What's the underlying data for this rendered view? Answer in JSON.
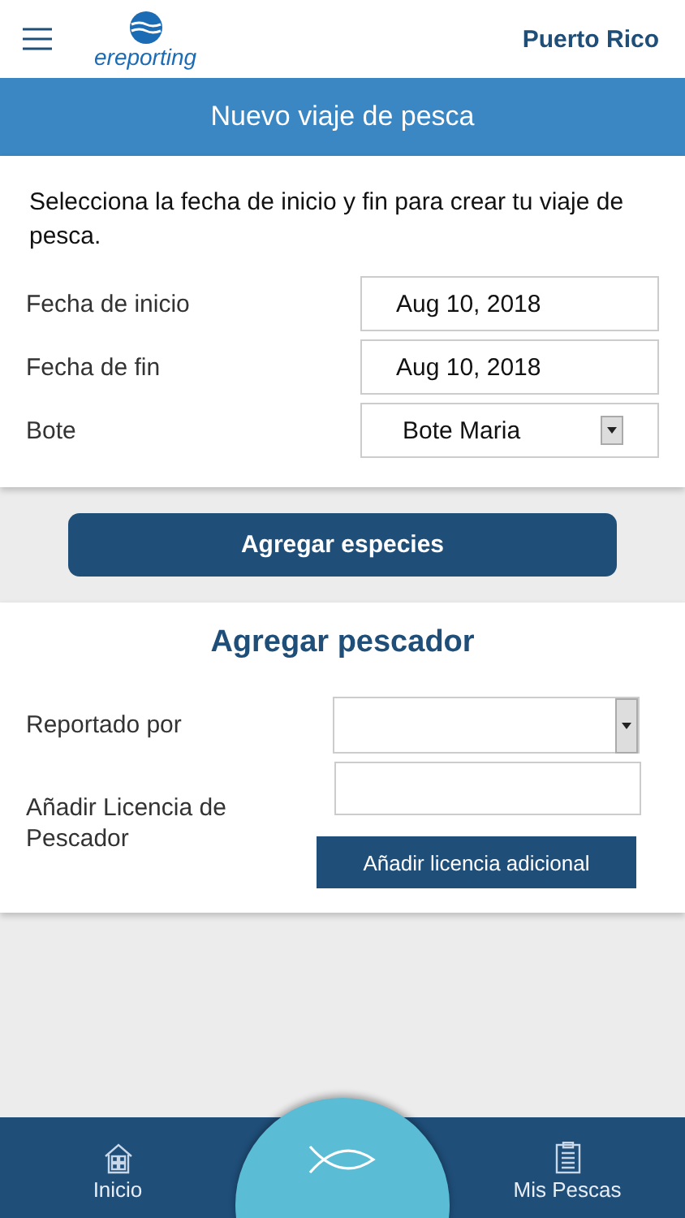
{
  "header": {
    "brand": "ereporting",
    "region": "Puerto Rico"
  },
  "banner": {
    "title": "Nuevo viaje de pesca"
  },
  "trip": {
    "instructions": "Selecciona la fecha de inicio y fin para crear tu viaje de pesca.",
    "fields": [
      {
        "label": "Fecha de inicio",
        "kind": "date",
        "value": "Aug 10, 2018"
      },
      {
        "label": "Fecha de fin",
        "kind": "date",
        "value": "Aug 10, 2018"
      },
      {
        "label": "Bote",
        "kind": "select",
        "value": "Bote Maria"
      }
    ]
  },
  "species_button": "Agregar especies",
  "fisher": {
    "title": "Agregar pescador",
    "reporter_label": "Reportado por",
    "license_label": "Añadir Licencia de Pescador",
    "license_button": "Añadir licencia adicional"
  },
  "nav": [
    {
      "label": "Inicio",
      "kind": "home"
    },
    {
      "kind": "fish"
    },
    {
      "label": "Mis Pescas",
      "kind": "list"
    }
  ]
}
